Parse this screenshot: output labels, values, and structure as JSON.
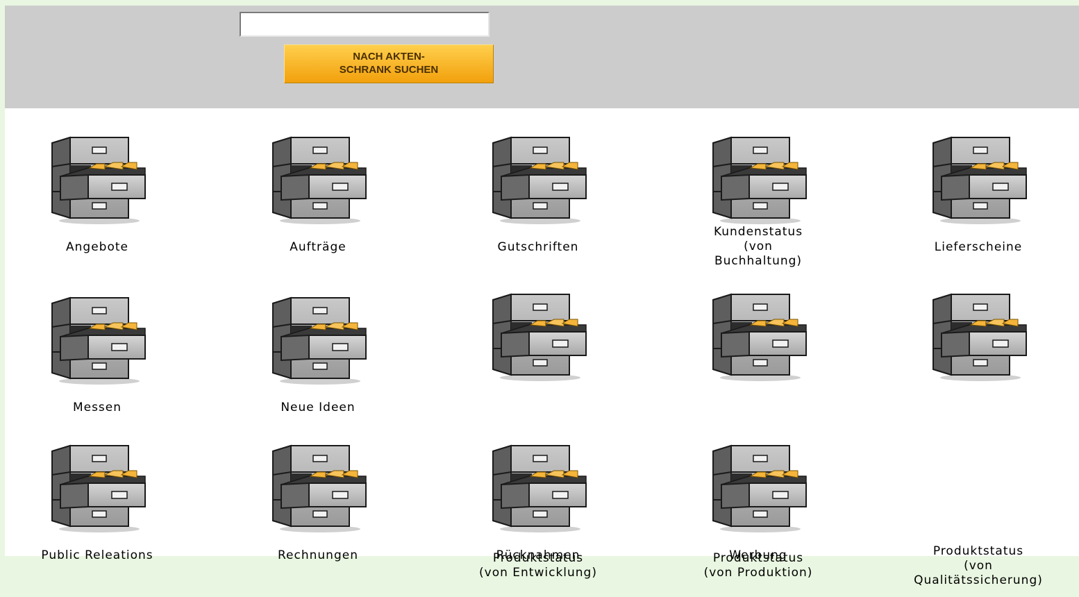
{
  "search": {
    "input_value": "",
    "button_line1": "NACH AKTEN-",
    "button_line2": "SCHRANK SUCHEN"
  },
  "cabinets": [
    {
      "lines": [
        "Angebote"
      ]
    },
    {
      "lines": [
        "Aufträge"
      ]
    },
    {
      "lines": [
        "Gutschriften"
      ]
    },
    {
      "lines": [
        "Kundenstatus",
        "(von",
        "Buchhaltung)"
      ]
    },
    {
      "lines": [
        "Lieferscheine"
      ]
    },
    {
      "lines": [
        "Messen"
      ]
    },
    {
      "lines": [
        "Neue Ideen"
      ]
    },
    {
      "lines": [
        "Produktstatus",
        "(von Entwicklung)"
      ]
    },
    {
      "lines": [
        "Produktstatus",
        "(von Produktion)"
      ]
    },
    {
      "lines": [
        "Produktstatus",
        "(von",
        "Qualitätssicherung)"
      ]
    },
    {
      "lines": [
        "Public Releations"
      ]
    },
    {
      "lines": [
        "Rechnungen"
      ]
    },
    {
      "lines": [
        "Rücknahmen"
      ]
    },
    {
      "lines": [
        "Werbung"
      ]
    }
  ],
  "colors": {
    "page_background": "#e9f6e1",
    "search_band": "#cccccc",
    "button": "#f2a00c",
    "folder_tabs": "#f5b53a"
  },
  "icons": {
    "cabinet": "filing-cabinet-icon"
  }
}
